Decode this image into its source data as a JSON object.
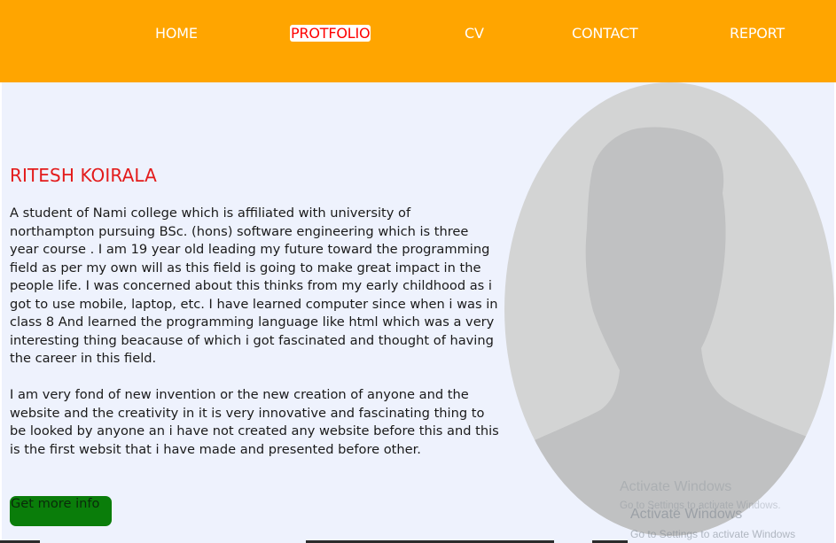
{
  "nav": {
    "items": [
      {
        "label": "HOME",
        "active": false
      },
      {
        "label": "PROTFOLIO",
        "active": true
      },
      {
        "label": "CV",
        "active": false
      },
      {
        "label": "CONTACT",
        "active": false
      },
      {
        "label": "REPORT",
        "active": false
      }
    ]
  },
  "profile": {
    "name": "RITESH KOIRALA",
    "paragraphs": [
      "A student of Nami college which is affiliated with university of northampton pursuing BSc. (hons) software engineering which is three year course . I am 19 year old leading my future toward the programming field as per my own will as this field is going to make great impact in the people life. I was concerned about this thinks from my early childhood as i got to use mobile, laptop, etc. I have learned computer since when i was in class 8 And learned the programming language like html which was a very interesting thing beacause of which i got fascinated and thought of having the career in this field.",
      "I am very fond of new invention or the new creation of anyone and the website and the creativity in it is very innovative and fascinating thing to be looked by anyone an i have not created any website before this and this is the first websit that i have made and presented before other."
    ],
    "more_button": "Get more info",
    "avatar_icon": "default-person-silhouette"
  },
  "watermark": {
    "title_1": "Activate Windows",
    "subtitle_1": "Go to Settings to activate Windows.",
    "title_2": "Activate Windows",
    "subtitle_2": "Go to Settings to activate Windows"
  },
  "colors": {
    "navbar_bg": "#ffa500",
    "content_bg": "#eef2fd",
    "name_color": "#e31b1b",
    "button_bg": "#0a7d0a",
    "avatar_bg": "#d3d4d4",
    "silhouette": "#c0c1c2"
  }
}
